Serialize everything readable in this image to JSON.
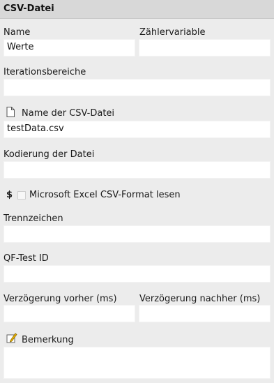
{
  "panel": {
    "title": "CSV-Datei"
  },
  "fields": {
    "name": {
      "label": "Name",
      "value": "Werte"
    },
    "counter": {
      "label": "Zählervariable",
      "value": ""
    },
    "iterations": {
      "label": "Iterationsbereiche",
      "value": ""
    },
    "csv_file": {
      "label": "Name der CSV-Datei",
      "value": "testData.csv",
      "icon": "file-icon"
    },
    "encoding": {
      "label": "Kodierung der Datei",
      "value": ""
    },
    "excel_csv": {
      "label": "Microsoft Excel CSV-Format lesen",
      "checked": false,
      "marker": "$"
    },
    "separator": {
      "label": "Trennzeichen",
      "value": ""
    },
    "qftest_id": {
      "label": "QF-Test ID",
      "value": ""
    },
    "delay_before": {
      "label": "Verzögerung vorher (ms)",
      "value": ""
    },
    "delay_after": {
      "label": "Verzögerung nachher (ms)",
      "value": ""
    },
    "comment": {
      "label": "Bemerkung",
      "value": "",
      "icon": "pencil-note-icon"
    }
  }
}
